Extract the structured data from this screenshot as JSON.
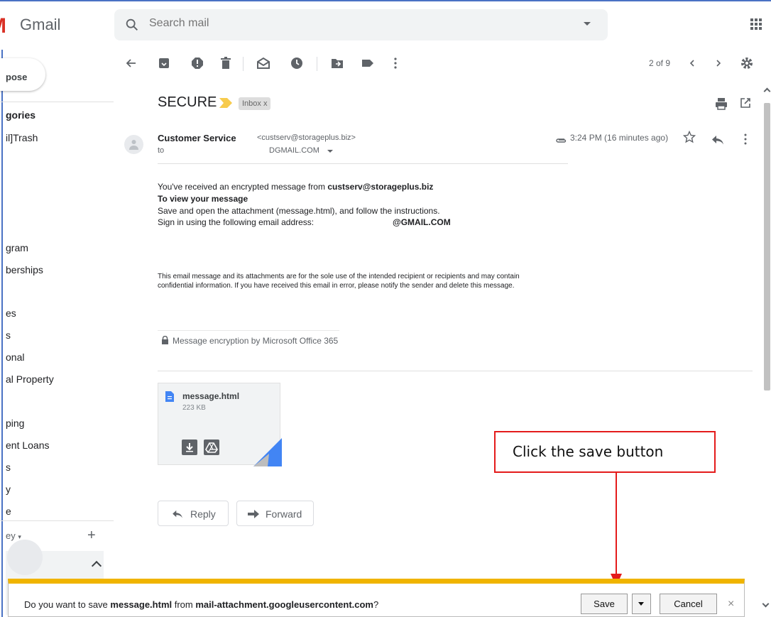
{
  "app": {
    "logo_text": "Gmail"
  },
  "search": {
    "placeholder": "Search mail"
  },
  "toolbar": {
    "page_counter": "2 of 9"
  },
  "sidebar": {
    "compose_label": "pose",
    "items": [
      {
        "label": "gories",
        "bold": true
      },
      {
        "label": "il]Trash"
      },
      {
        "label": "gram"
      },
      {
        "label": "berships"
      },
      {
        "label": "es"
      },
      {
        "label": "s"
      },
      {
        "label": "onal"
      },
      {
        "label": "al Property"
      },
      {
        "label": "ping"
      },
      {
        "label": "ent Loans"
      },
      {
        "label": "s"
      },
      {
        "label": "y"
      },
      {
        "label": "e"
      }
    ],
    "hangouts_user": "ey",
    "hangouts_add": "+"
  },
  "message": {
    "subject": "SECURE",
    "label_badge": "Inbox",
    "label_badge_close": "x",
    "sender_name": "Customer Service",
    "sender_email": "<custserv@storageplus.biz>",
    "to_label": "to",
    "to_address": "DGMAIL.COM",
    "timestamp": "3:24 PM (16 minutes ago)",
    "body": {
      "line1_prefix": "You've received an encrypted message from ",
      "line1_sender": "custserv@storageplus.biz",
      "heading": "To view your message",
      "line2": "Save and open the attachment (message.html), and follow the instructions.",
      "line3": "Sign in using the following email address:",
      "email_suffix": "@GMAIL.COM",
      "disclaimer1": "This email message and its attachments are for the sole use of the intended recipient or recipients and may contain",
      "disclaimer2": "confidential information. If you have received this email in error, please notify the sender and delete this message.",
      "encryption_note": "Message encryption by Microsoft Office 365"
    },
    "attachment": {
      "name": "message.html",
      "size": "223 KB"
    },
    "actions": {
      "reply": "Reply",
      "forward": "Forward"
    }
  },
  "annotation": {
    "text": "Click the save button"
  },
  "download_bar": {
    "prefix": "Do you want to save ",
    "file": "message.html",
    "middle": " from ",
    "host": "mail-attachment.googleusercontent.com",
    "suffix": "?",
    "save": "Save",
    "cancel": "Cancel",
    "close": "×"
  },
  "colors": {
    "brand_red": "#d93025",
    "annotation_red": "#e41b1b",
    "download_bar_accent": "#f0b400",
    "importance_marker": "#f7cb4d"
  }
}
